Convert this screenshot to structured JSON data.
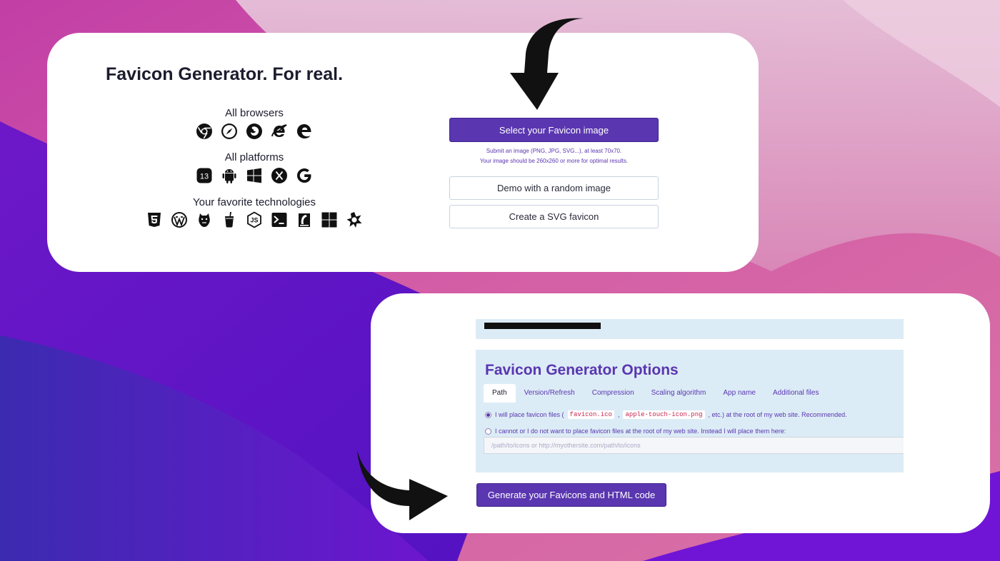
{
  "header": {
    "title": "Favicon Generator. For real."
  },
  "platforms": {
    "browsers": {
      "label": "All browsers",
      "icons": [
        "chrome-icon",
        "safari-icon",
        "firefox-icon",
        "internet-explorer-icon",
        "edge-icon"
      ]
    },
    "platforms": {
      "label": "All platforms",
      "icons": [
        "ios-icon",
        "android-icon",
        "windows-icon",
        "macos-icon",
        "google-icon"
      ],
      "ios_text": "13"
    },
    "technologies": {
      "label": "Your favorite technologies",
      "icons": [
        "html5-icon",
        "wordpress-icon",
        "gulp-icon",
        "grunt-icon",
        "nodejs-icon",
        "terminal-icon",
        "ruby-on-rails-icon",
        "aspnet-icon",
        "joomla-icon"
      ],
      "node_text": "JS"
    }
  },
  "upload": {
    "select_label": "Select your Favicon image",
    "hint_line1": "Submit an image (PNG, JPG, SVG...), at least 70x70.",
    "hint_line2": "Your image should be 260x260 or more for optimal results.",
    "demo_label": "Demo with a random image",
    "svg_label": "Create a SVG favicon"
  },
  "options": {
    "title": "Favicon Generator Options",
    "tabs": [
      "Path",
      "Version/Refresh",
      "Compression",
      "Scaling algorithm",
      "App name",
      "Additional files"
    ],
    "active_tab": "Path",
    "radio1_prefix": "I will place favicon files (",
    "radio1_code1": "favicon.ico",
    "radio1_sep": ",",
    "radio1_code2": "apple-touch-icon.png",
    "radio1_suffix": ", etc.) at the root of my web site. Recommended.",
    "radio2_label": "I cannot or I do not want to place favicon files at the root of my web site. Instead I will place them here:",
    "path_placeholder": "/path/to/icons or http://myothersite.com/path/to/icons",
    "generate_label": "Generate your Favicons and HTML code"
  },
  "colors": {
    "accent": "#5a36b0",
    "panel": "#dcecf6",
    "code_red": "#c7254e"
  }
}
